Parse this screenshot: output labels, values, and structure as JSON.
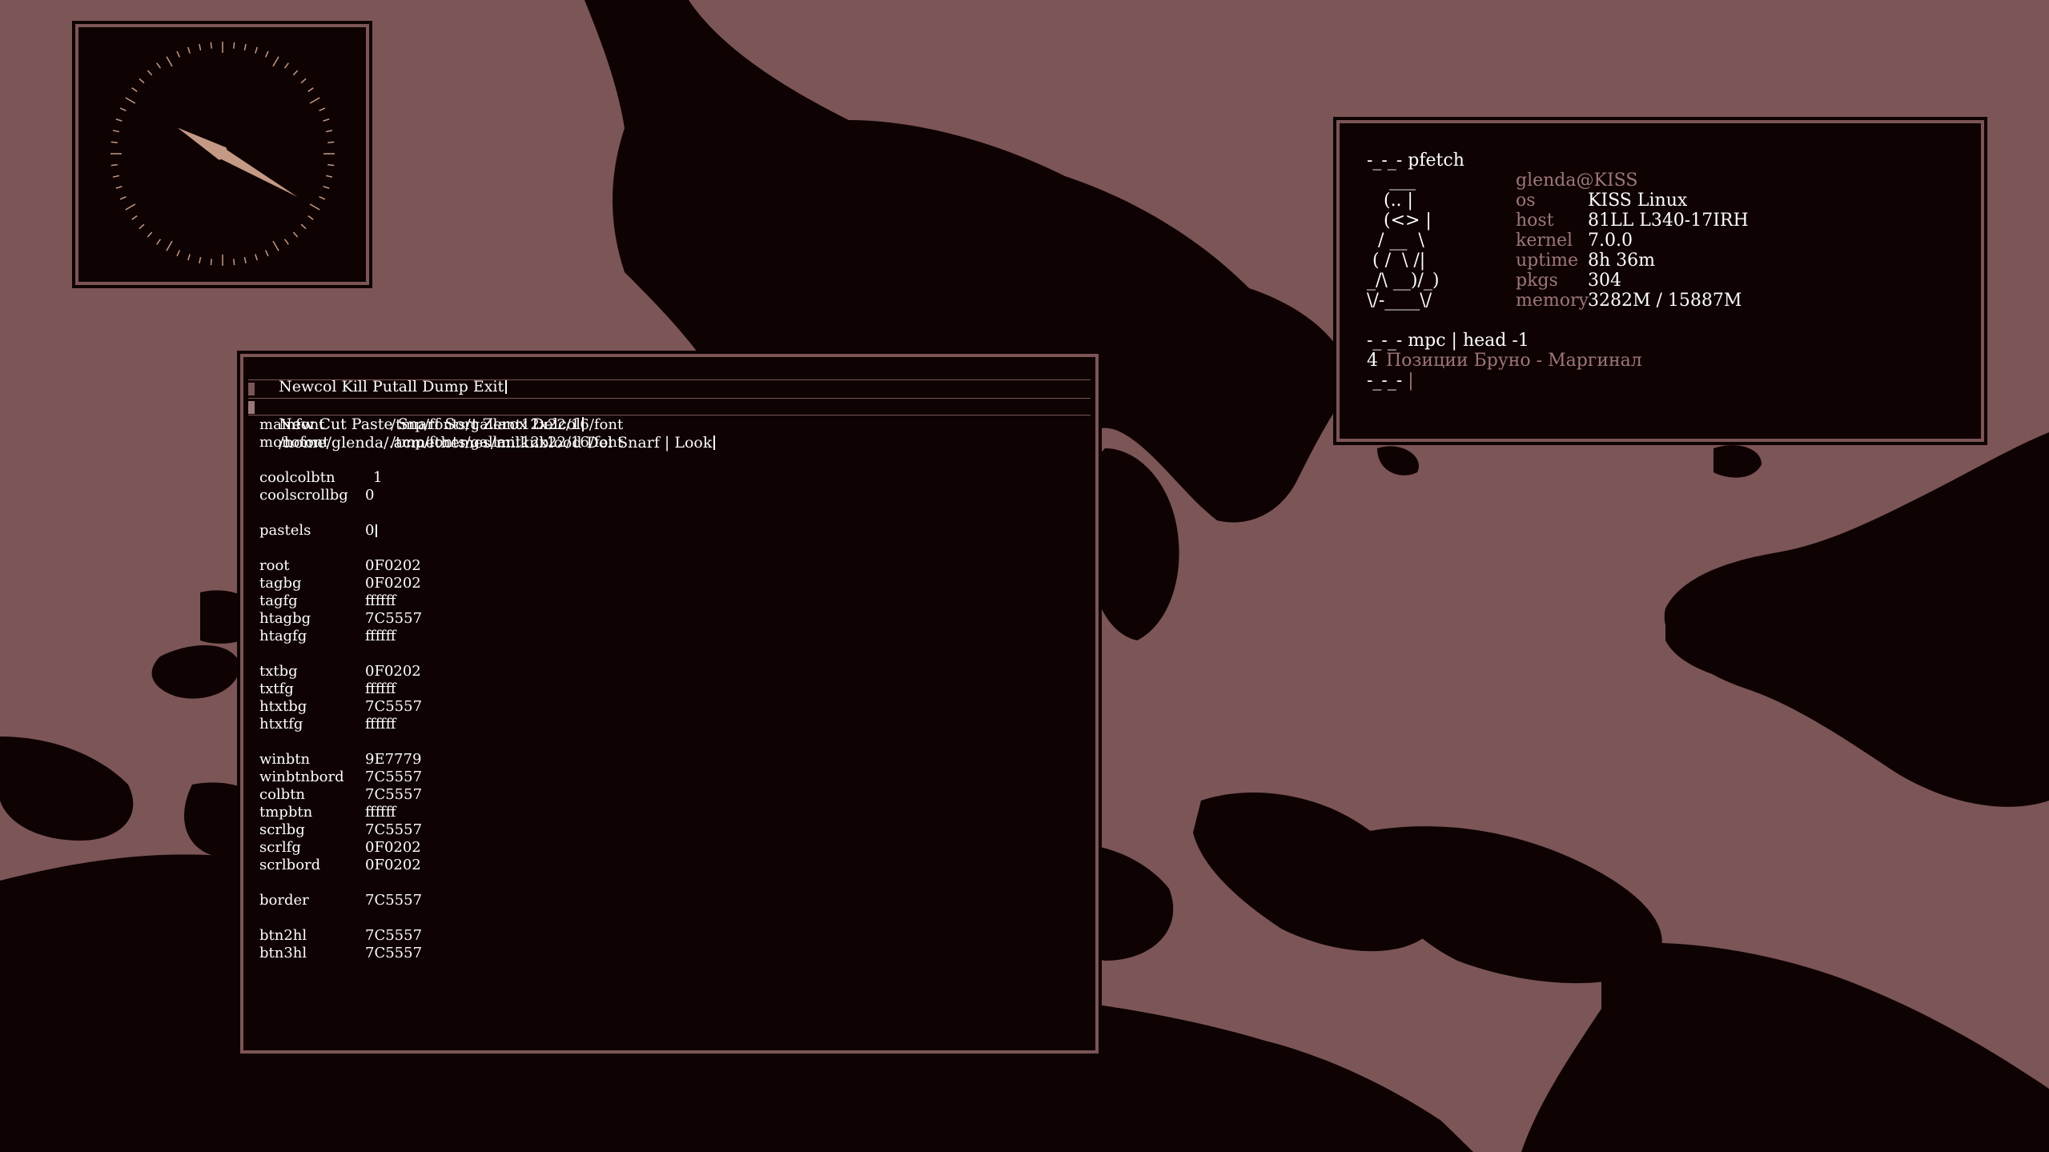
{
  "colors": {
    "root": "#0F0202",
    "accent": "#7C5557",
    "winbtn": "#9E7779",
    "text": "#ffffff",
    "hand": "#C49A86"
  },
  "clock": {
    "hour_hand_deg": 300,
    "minute_hand_deg": 120
  },
  "pfetch": {
    "header": "-_-_- pfetch",
    "ascii": [
      "    ___",
      "   (.. |",
      "   (<> |",
      "  / __  \\",
      " ( /  \\ /|",
      "_/\\ __)/_)",
      "\\/-____\\/"
    ],
    "user": "glenda@KISS",
    "fields": [
      {
        "key": "os",
        "value": "KISS Linux"
      },
      {
        "key": "host",
        "value": "81LL L340-17IRH"
      },
      {
        "key": "kernel",
        "value": "7.0.0"
      },
      {
        "key": "uptime",
        "value": "8h 36m"
      },
      {
        "key": "pkgs",
        "value": "304"
      },
      {
        "key": "memory",
        "value": "3282M / 15887M"
      }
    ],
    "mpc_header": "-_-_- mpc | head -1",
    "mpc_track_num": "4",
    "mpc_track": "Позиции Бруно - Маргинал",
    "prompt": "-_-_-"
  },
  "acme": {
    "main_tag": "Newcol Kill Putall Dump Exit",
    "col_tag": "New Cut Paste Snarf Sort Zerox Delcol",
    "win_tag": "/home/glenda/.acmethemes/milknblood Del Snarf | Look",
    "lines": [
      {
        "k": "mainfont",
        "v": "/tmp/fonts/gallant12x22/16/font",
        "far": true
      },
      {
        "k": "monofont",
        "v": "/tmp/fonts/gallant12x22/16/font",
        "far": true
      },
      {
        "k": "",
        "v": ""
      },
      {
        "k": "coolcolbtn",
        "v": "1",
        "mid": true
      },
      {
        "k": "coolscrollbg",
        "v": "0"
      },
      {
        "k": "",
        "v": ""
      },
      {
        "k": "pastels",
        "v": "0",
        "cursor": true
      },
      {
        "k": "",
        "v": ""
      },
      {
        "k": "root",
        "v": "0F0202"
      },
      {
        "k": "tagbg",
        "v": "0F0202"
      },
      {
        "k": "tagfg",
        "v": "ffffff"
      },
      {
        "k": "htagbg",
        "v": "7C5557"
      },
      {
        "k": "htagfg",
        "v": "ffffff"
      },
      {
        "k": "",
        "v": ""
      },
      {
        "k": "txtbg",
        "v": "0F0202"
      },
      {
        "k": "txtfg",
        "v": "ffffff"
      },
      {
        "k": "htxtbg",
        "v": "7C5557"
      },
      {
        "k": "htxtfg",
        "v": "ffffff"
      },
      {
        "k": "",
        "v": ""
      },
      {
        "k": "winbtn",
        "v": "9E7779"
      },
      {
        "k": "winbtnbord",
        "v": "7C5557"
      },
      {
        "k": "colbtn",
        "v": "7C5557"
      },
      {
        "k": "tmpbtn",
        "v": "ffffff"
      },
      {
        "k": "scrlbg",
        "v": "7C5557"
      },
      {
        "k": "scrlfg",
        "v": "0F0202"
      },
      {
        "k": "scrlbord",
        "v": "0F0202"
      },
      {
        "k": "",
        "v": ""
      },
      {
        "k": "border",
        "v": "7C5557"
      },
      {
        "k": "",
        "v": ""
      },
      {
        "k": "btn2hl",
        "v": "7C5557"
      },
      {
        "k": "btn3hl",
        "v": "7C5557"
      }
    ]
  }
}
